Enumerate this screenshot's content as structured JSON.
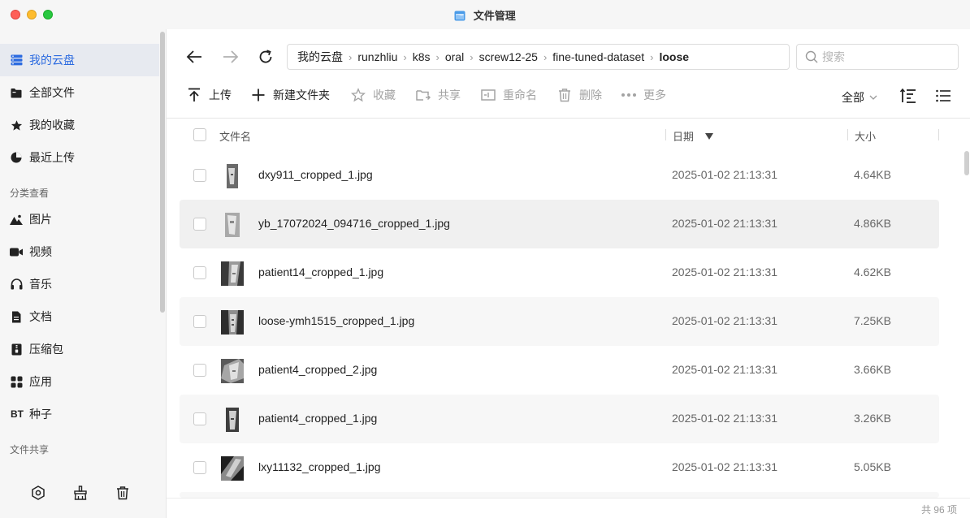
{
  "window": {
    "title": "文件管理"
  },
  "sidebar": {
    "items": [
      {
        "label": "我的云盘",
        "icon": "cloud-drive-icon",
        "active": true
      },
      {
        "label": "全部文件",
        "icon": "folder-icon"
      },
      {
        "label": "我的收藏",
        "icon": "star-icon"
      },
      {
        "label": "最近上传",
        "icon": "clock-icon"
      }
    ],
    "category_title": "分类查看",
    "categories": [
      {
        "label": "图片",
        "icon": "image-icon"
      },
      {
        "label": "视频",
        "icon": "video-icon"
      },
      {
        "label": "音乐",
        "icon": "headphones-icon"
      },
      {
        "label": "文档",
        "icon": "document-icon"
      },
      {
        "label": "压缩包",
        "icon": "archive-icon"
      },
      {
        "label": "应用",
        "icon": "apps-icon"
      },
      {
        "label": "种子",
        "icon": "bt-icon",
        "icon_text": "BT"
      }
    ],
    "share_title": "文件共享",
    "bottom_icons": [
      "settings-icon",
      "cleanup-icon",
      "trash-icon"
    ]
  },
  "path": {
    "crumbs": [
      "我的云盘",
      "runzhliu",
      "k8s",
      "oral",
      "screw12-25",
      "fine-tuned-dataset",
      "loose"
    ]
  },
  "search": {
    "placeholder": "搜索"
  },
  "toolbar": {
    "upload": "上传",
    "new_folder": "新建文件夹",
    "favorite": "收藏",
    "share": "共享",
    "rename": "重命名",
    "delete": "删除",
    "more": "更多",
    "filter": "全部"
  },
  "table": {
    "headers": {
      "name": "文件名",
      "date": "日期",
      "size": "大小"
    },
    "rows": [
      {
        "name": "dxy911_cropped_1.jpg",
        "date": "2025-01-02 21:13:31",
        "size": "4.64KB"
      },
      {
        "name": "yb_17072024_094716_cropped_1.jpg",
        "date": "2025-01-02 21:13:31",
        "size": "4.86KB"
      },
      {
        "name": "patient14_cropped_1.jpg",
        "date": "2025-01-02 21:13:31",
        "size": "4.62KB"
      },
      {
        "name": "loose-ymh1515_cropped_1.jpg",
        "date": "2025-01-02 21:13:31",
        "size": "7.25KB"
      },
      {
        "name": "patient4_cropped_2.jpg",
        "date": "2025-01-02 21:13:31",
        "size": "3.66KB"
      },
      {
        "name": "patient4_cropped_1.jpg",
        "date": "2025-01-02 21:13:31",
        "size": "3.26KB"
      },
      {
        "name": "lxy11132_cropped_1.jpg",
        "date": "2025-01-02 21:13:31",
        "size": "5.05KB"
      }
    ]
  },
  "footer": {
    "count": "共 96 项"
  },
  "colors": {
    "accent": "#2c6be0",
    "sidebar_bg": "#f6f6f6",
    "active_bg": "#e7eaf0"
  }
}
